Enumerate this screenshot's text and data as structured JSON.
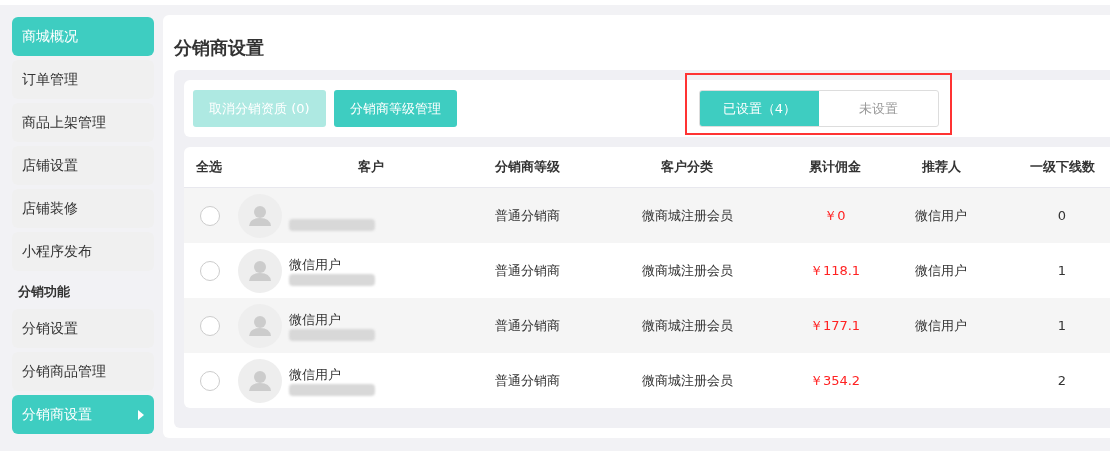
{
  "sidebar": {
    "items": [
      {
        "kind": "home",
        "label": "商城概况"
      },
      {
        "kind": "item",
        "label": "订单管理",
        "selected": false
      },
      {
        "kind": "item",
        "label": "商品上架管理",
        "selected": false
      },
      {
        "kind": "item",
        "label": "店铺设置",
        "selected": false
      },
      {
        "kind": "item",
        "label": "店铺装修",
        "selected": false
      },
      {
        "kind": "item",
        "label": "小程序发布",
        "selected": false
      },
      {
        "kind": "section",
        "label": "分销功能"
      },
      {
        "kind": "item",
        "label": "分销设置",
        "selected": false
      },
      {
        "kind": "item",
        "label": "分销商品管理",
        "selected": false
      },
      {
        "kind": "item",
        "label": "分销商设置",
        "selected": true
      }
    ]
  },
  "page_title": "分销商设置",
  "toolbar": {
    "buttons": [
      {
        "label": "取消分销资质 (0)",
        "disabled": true
      },
      {
        "label": "分销商等级管理",
        "disabled": false
      }
    ],
    "tabs_highlighted": true,
    "tabs": [
      {
        "label": "已设置（4）",
        "selected": true
      },
      {
        "label": "未设置",
        "selected": false
      }
    ]
  },
  "table": {
    "columns": [
      "全选",
      "客户",
      "分销商等级",
      "客户分类",
      "累计佣金",
      "推荐人",
      "一级下线数"
    ],
    "rows": [
      {
        "checked": false,
        "redacted": true,
        "grade": "普通分销商",
        "category": "微商城注册会员",
        "commission": "￥0",
        "referrer": "微信用户",
        "downlines": "0"
      },
      {
        "checked": false,
        "name": "微信用户",
        "redacted": true,
        "grade": "普通分销商",
        "category": "微商城注册会员",
        "commission": "￥118.1",
        "referrer": "微信用户",
        "downlines": "1"
      },
      {
        "checked": false,
        "name": "微信用户",
        "redacted": true,
        "grade": "普通分销商",
        "category": "微商城注册会员",
        "commission": "￥177.1",
        "referrer": "微信用户",
        "downlines": "1"
      },
      {
        "checked": false,
        "name": "微信用户",
        "redacted": true,
        "grade": "普通分销商",
        "category": "微商城注册会员",
        "commission": "￥354.2",
        "downlines": "2"
      }
    ]
  }
}
